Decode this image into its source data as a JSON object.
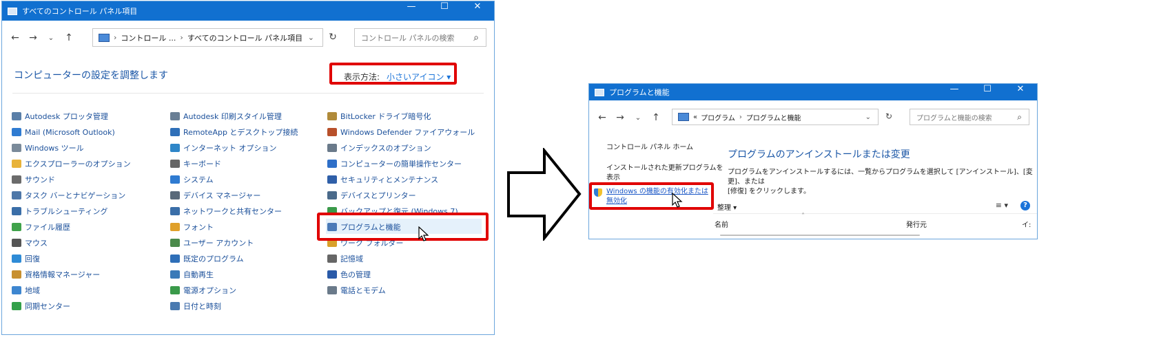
{
  "left_window": {
    "title": "すべてのコントロール パネル項目",
    "window_controls": {
      "minimize": "—",
      "maximize": "☐",
      "close": "✕"
    },
    "nav": {
      "back": "←",
      "forward": "→",
      "recent": "⌄",
      "up": "↑",
      "refresh": "↻"
    },
    "address": {
      "crumb1": "コントロール ...",
      "crumb2": "すべてのコントロール パネル項目",
      "separator": "›",
      "first_separator": "›",
      "dropdown": "⌄"
    },
    "search": {
      "placeholder": "コントロール パネルの検索",
      "icon": "search-icon"
    },
    "heading": "コンピューターの設定を調整します",
    "view_by": {
      "label": "表示方法:",
      "value": "小さいアイコン ▾"
    },
    "columns": [
      [
        {
          "label": "Autodesk プロッタ管理",
          "icon": "plotter-icon",
          "color": "#5a7fa8"
        },
        {
          "label": "Mail (Microsoft Outlook)",
          "icon": "mail-icon",
          "color": "#2f7bd1"
        },
        {
          "label": "Windows ツール",
          "icon": "tools-icon",
          "color": "#7a8a9a"
        },
        {
          "label": "エクスプローラーのオプション",
          "icon": "folder-options-icon",
          "color": "#e8b33a"
        },
        {
          "label": "サウンド",
          "icon": "speaker-icon",
          "color": "#6b6b6b"
        },
        {
          "label": "タスク バーとナビゲーション",
          "icon": "taskbar-icon",
          "color": "#4e77a8"
        },
        {
          "label": "トラブルシューティング",
          "icon": "troubleshoot-icon",
          "color": "#3a6ea8"
        },
        {
          "label": "ファイル履歴",
          "icon": "file-history-icon",
          "color": "#3fa24a"
        },
        {
          "label": "マウス",
          "icon": "mouse-icon",
          "color": "#555555"
        },
        {
          "label": "回復",
          "icon": "recovery-icon",
          "color": "#2e8bd6"
        },
        {
          "label": "資格情報マネージャー",
          "icon": "credential-icon",
          "color": "#c89030"
        },
        {
          "label": "地域",
          "icon": "region-icon",
          "color": "#3d86d0"
        },
        {
          "label": "同期センター",
          "icon": "sync-icon",
          "color": "#33a04a"
        }
      ],
      [
        {
          "label": "Autodesk 印刷スタイル管理",
          "icon": "print-style-icon",
          "color": "#6a7f95"
        },
        {
          "label": "RemoteApp とデスクトップ接続",
          "icon": "remoteapp-icon",
          "color": "#2f6fb8"
        },
        {
          "label": "インターネット オプション",
          "icon": "internet-options-icon",
          "color": "#2e86c8"
        },
        {
          "label": "キーボード",
          "icon": "keyboard-icon",
          "color": "#666666"
        },
        {
          "label": "システム",
          "icon": "system-icon",
          "color": "#2f7bd1"
        },
        {
          "label": "デバイス マネージャー",
          "icon": "device-manager-icon",
          "color": "#5a6a7a"
        },
        {
          "label": "ネットワークと共有センター",
          "icon": "network-icon",
          "color": "#3a6ea8"
        },
        {
          "label": "フォント",
          "icon": "font-icon",
          "color": "#e0a02a"
        },
        {
          "label": "ユーザー アカウント",
          "icon": "users-icon",
          "color": "#4a8a4a"
        },
        {
          "label": "既定のプログラム",
          "icon": "default-programs-icon",
          "color": "#2f6fb8"
        },
        {
          "label": "自動再生",
          "icon": "autoplay-icon",
          "color": "#3a7ab8"
        },
        {
          "label": "電源オプション",
          "icon": "power-icon",
          "color": "#3a9a4a"
        },
        {
          "label": "日付と時刻",
          "icon": "clock-icon",
          "color": "#4a7ab0"
        }
      ],
      [
        {
          "label": "BitLocker ドライブ暗号化",
          "icon": "bitlocker-icon",
          "color": "#b08a3a"
        },
        {
          "label": "Windows Defender ファイアウォール",
          "icon": "firewall-icon",
          "color": "#b8502a"
        },
        {
          "label": "インデックスのオプション",
          "icon": "indexing-icon",
          "color": "#6a7a8a"
        },
        {
          "label": "コンピューターの簡単操作センター",
          "icon": "ease-of-access-icon",
          "color": "#2e6fc8"
        },
        {
          "label": "セキュリティとメンテナンス",
          "icon": "flag-icon",
          "color": "#2f5fa8"
        },
        {
          "label": "デバイスとプリンター",
          "icon": "printer-icon",
          "color": "#4a6a8a"
        },
        {
          "label": "バックアップと復元 (Windows 7)",
          "icon": "backup-icon",
          "color": "#3a9a4a"
        },
        {
          "label": "プログラムと機能",
          "icon": "programs-icon",
          "color": "#4a7ab8"
        },
        {
          "label": "ワーク フォルダー",
          "icon": "work-folders-icon",
          "color": "#d8a02a"
        },
        {
          "label": "記憶域",
          "icon": "storage-icon",
          "color": "#666666"
        },
        {
          "label": "色の管理",
          "icon": "color-management-icon",
          "color": "#2a5aa8"
        },
        {
          "label": "電話とモデム",
          "icon": "phone-modem-icon",
          "color": "#6a7a8a"
        }
      ]
    ]
  },
  "arrow": {
    "icon": "right-arrow-icon"
  },
  "right_window": {
    "title": "プログラムと機能",
    "window_controls": {
      "minimize": "—",
      "maximize": "☐",
      "close": "✕"
    },
    "nav": {
      "back": "←",
      "forward": "→",
      "recent": "⌄",
      "up": "↑",
      "refresh": "↻"
    },
    "address": {
      "prefix": "«",
      "crumb1": "プログラム",
      "crumb2": "プログラムと機能",
      "separator": "›",
      "dropdown": "⌄"
    },
    "search": {
      "placeholder": "プログラムと機能の検索",
      "icon": "search-icon"
    },
    "sidebar": {
      "home": "コントロール パネル ホーム",
      "updates_line1": "インストールされた更新プログラムを",
      "updates_line2": "表示",
      "features_line1": "Windows の機能の有効化または",
      "features_line2": "無効化"
    },
    "heading": "プログラムのアンインストールまたは変更",
    "description_line1": "プログラムをアンインストールするには、一覧からプログラムを選択して [アンインストール]、[変更]、または",
    "description_line2": "[修復] をクリックします。",
    "toolbar": {
      "organize": "整理 ▾",
      "view": "≡ ▾",
      "help": "?"
    },
    "columns": {
      "name": "名前",
      "publisher": "発行元",
      "sort": "˄",
      "third": "イ:"
    }
  }
}
